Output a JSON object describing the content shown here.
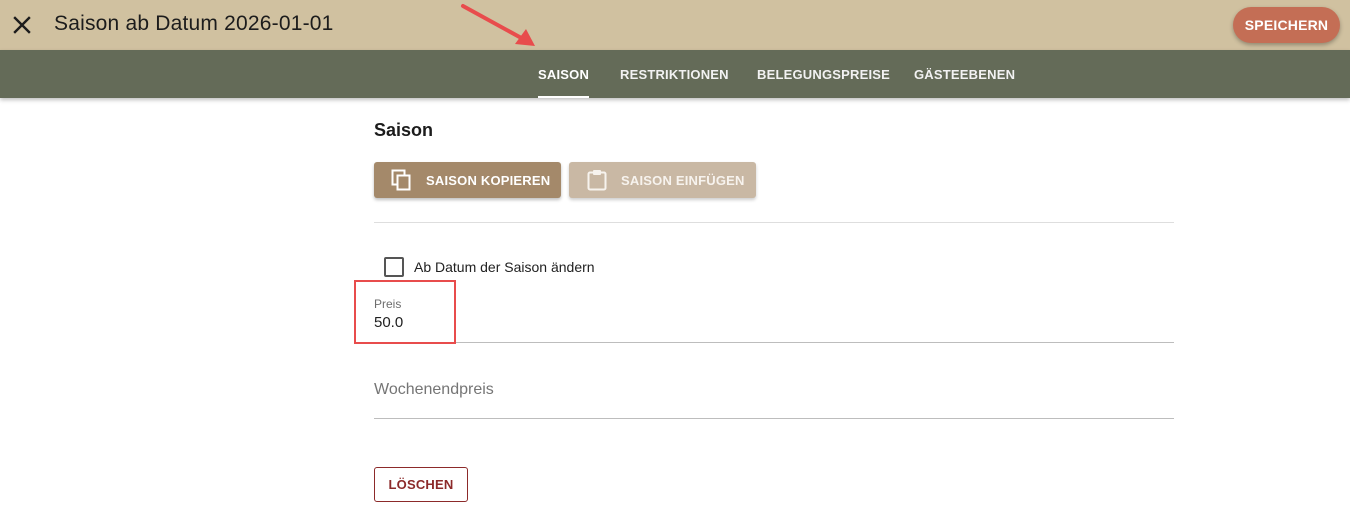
{
  "header": {
    "title": "Saison ab Datum 2026-01-01",
    "close_icon": "close-icon",
    "save_label": "SPEICHERN"
  },
  "tabs": [
    {
      "label": "SAISON",
      "active": true
    },
    {
      "label": "RESTRIKTIONEN",
      "active": false
    },
    {
      "label": "BELEGUNGSPREISE",
      "active": false
    },
    {
      "label": "GÄSTEEBENEN",
      "active": false
    }
  ],
  "main": {
    "section_title": "Saison",
    "copy_button": {
      "label": "SAISON KOPIEREN",
      "icon": "copy-icon"
    },
    "paste_button": {
      "label": "SAISON EINFÜGEN",
      "icon": "clipboard-icon"
    },
    "checkbox": {
      "label": "Ab Datum der Saison ändern",
      "checked": false
    },
    "price": {
      "label": "Preis",
      "value": "50.0"
    },
    "weekend_price": {
      "placeholder": "Wochenendpreis",
      "value": ""
    },
    "delete_label": "LÖSCHEN"
  },
  "colors": {
    "header_bg": "#d0c1a0",
    "tabbar_bg": "#646b58",
    "save_button": "#c46e55",
    "copy_button": "#a4896a",
    "paste_button": "#c9b8a4",
    "delete_text": "#8c2a2a",
    "annotation_red": "#e84c4c"
  }
}
